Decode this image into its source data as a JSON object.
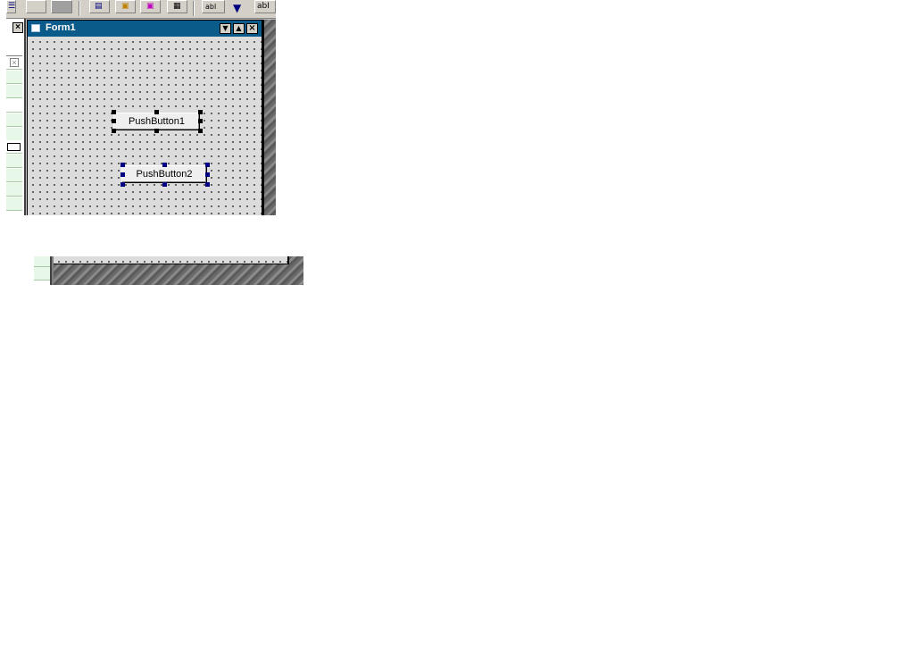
{
  "toolbar": {
    "item_text_label": "abl",
    "item_text2_label": "abI"
  },
  "palette": {
    "close_label": "×"
  },
  "form": {
    "title": "Form1",
    "dropdown_glyph": "▼",
    "maximize_glyph": "▲",
    "close_glyph": "×"
  },
  "buttons": {
    "push1": "PushButton1",
    "push2": "PushButton2"
  },
  "colors": {
    "titlebar": "#0a5a8a",
    "selection_primary": "#000000",
    "selection_secondary": "#000080"
  }
}
